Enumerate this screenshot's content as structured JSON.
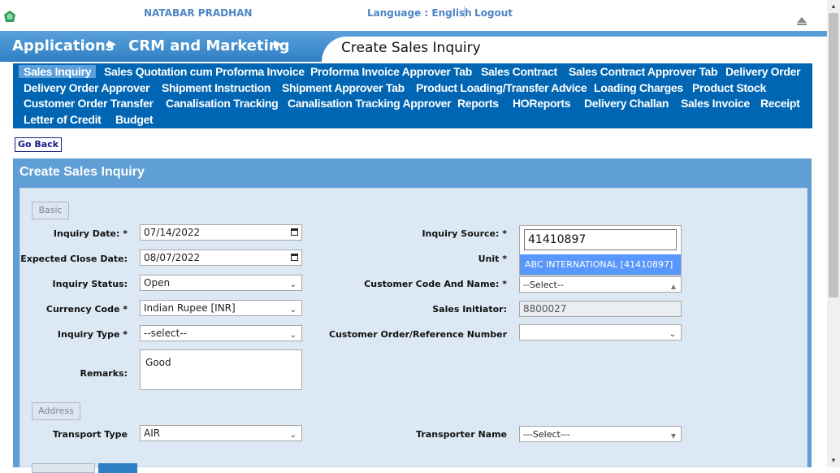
{
  "header": {
    "user_name": "NATABAR PRADHAN",
    "language_label": "Language : English",
    "logout_label": "Logout"
  },
  "breadcrumb": {
    "applications": "Applications",
    "module": "CRM and Marketing",
    "page_title": "Create Sales Inquiry"
  },
  "menu": {
    "items": [
      "Sales Inquiry",
      "Sales Quotation cum Proforma Invoice",
      "Proforma Invoice Approver Tab",
      "Sales Contract",
      "Sales Contract Approver Tab",
      "Delivery Order",
      "Delivery Order Approver",
      "Shipment Instruction",
      "Shipment Approver Tab",
      "Product Loading/Transfer Advice",
      "Loading Charges",
      "Product Stock",
      "Customer Order Transfer",
      "Canalisation Tracking",
      "Canalisation Tracking Approver",
      "Reports",
      "HOReports",
      "Delivery Challan",
      "Sales Invoice",
      "Receipt",
      "Letter of Credit",
      "Budget"
    ],
    "active": "Sales Inquiry"
  },
  "go_back_label": "Go Back",
  "panel_title": "Create Sales Inquiry",
  "sections": {
    "basic": "Basic",
    "address": "Address"
  },
  "form": {
    "inquiry_date": {
      "label": "Inquiry Date: *",
      "value": "07/14/2022"
    },
    "expected_close_date": {
      "label": "Expected Close Date:",
      "value": "08/07/2022"
    },
    "inquiry_status": {
      "label": "Inquiry Status:",
      "value": "Open"
    },
    "currency_code": {
      "label": "Currency Code *",
      "value": "Indian Rupee [INR]"
    },
    "inquiry_type": {
      "label": "Inquiry Type *",
      "value": "--select--"
    },
    "remarks": {
      "label": "Remarks:",
      "value": "Good"
    },
    "inquiry_source": {
      "label": "Inquiry Source: *"
    },
    "unit": {
      "label": "Unit *"
    },
    "customer": {
      "label": "Customer Code And Name: *",
      "value": "--Select--"
    },
    "sales_initiator": {
      "label": "Sales Initiator:",
      "value": "8800027"
    },
    "customer_order_ref": {
      "label": "Customer Order/Reference Number",
      "value": ""
    },
    "transport_type": {
      "label": "Transport Type",
      "value": "AIR"
    },
    "transporter_name": {
      "label": "Transporter Name",
      "value": "---Select---"
    }
  },
  "customer_dropdown": {
    "search_value": "41410897",
    "options": [
      "ABC INTERNATIONAL [41410897]"
    ]
  }
}
